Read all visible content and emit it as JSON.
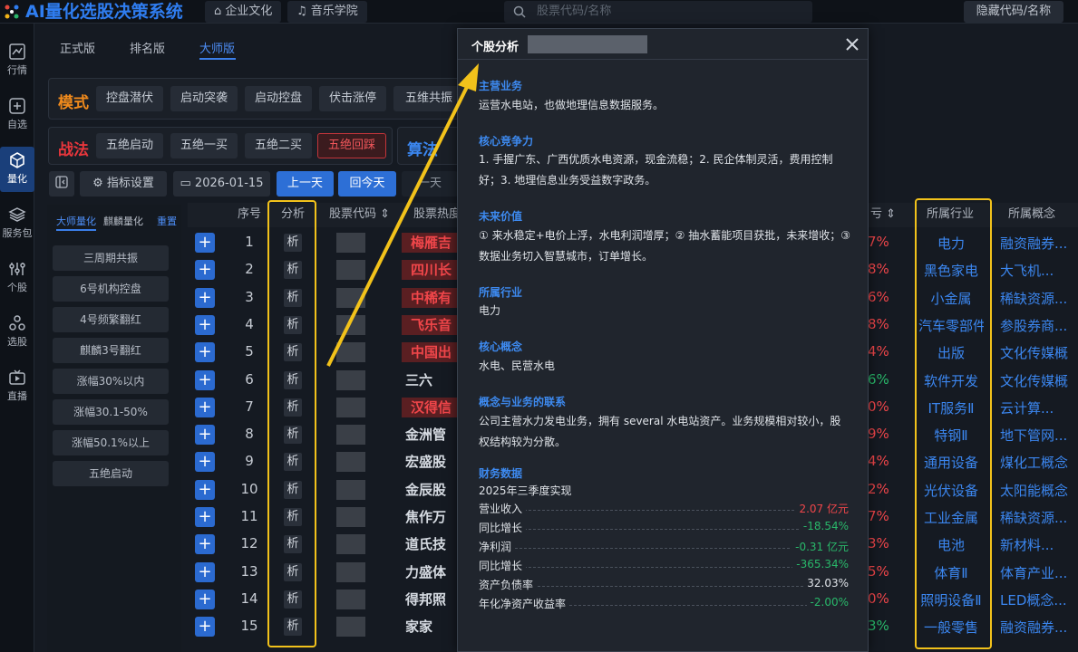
{
  "app": {
    "title": "AI量化选股决策系统",
    "top_buttons": [
      "企业文化",
      "音乐学院"
    ],
    "search_placeholder": "股票代码/名称",
    "hide_code_label": "隐藏代码/名称"
  },
  "left_nav": [
    {
      "label": "行情",
      "icon": "chart-icon"
    },
    {
      "label": "自选",
      "icon": "add-watchlist-icon"
    },
    {
      "label": "量化",
      "icon": "cube-icon",
      "active": true
    },
    {
      "label": "服务包",
      "icon": "layers-icon"
    },
    {
      "label": "个股",
      "icon": "sliders-icon"
    },
    {
      "label": "选股",
      "icon": "nodes-icon"
    },
    {
      "label": "直播",
      "icon": "tv-icon"
    }
  ],
  "version_tabs": [
    "正式版",
    "排名版",
    "大师版"
  ],
  "mode_row": {
    "label": "模式",
    "buttons": [
      "控盘潜伏",
      "启动突袭",
      "启动控盘",
      "伏击涨停",
      "五维共振"
    ]
  },
  "tactic_row": {
    "label": "战法",
    "buttons": [
      "五绝启动",
      "五绝一买",
      "五绝二买",
      "五绝回踩"
    ],
    "active_index": 3,
    "algo_label": "算法"
  },
  "toolbar": {
    "indicator_settings": "指标设置",
    "date": "2026-01-15",
    "prev_day": "上一天",
    "back_today": "回今天",
    "next_day": "一天"
  },
  "sub_panel": {
    "tabs": [
      "大师量化",
      "麒麟量化"
    ],
    "reset": "重置",
    "strategies": [
      "三周期共振",
      "6号机构控盘",
      "4号频繁翻红",
      "麒麟3号翻红",
      "涨幅30%以内",
      "涨幅30.1-50%",
      "涨幅50.1%以上",
      "五绝启动"
    ]
  },
  "table": {
    "headers": {
      "seq": "序号",
      "analysis": "分析",
      "code": "股票代码",
      "heat": "股票热度",
      "pnl": "亏",
      "industry": "所属行业",
      "concept": "所属概念"
    },
    "analysis_label": "析",
    "rows": [
      {
        "seq": "1",
        "name": "梅雁吉",
        "hot": true,
        "pct": "7%",
        "pct_color": "#f0464a",
        "industry": "电力",
        "concept": "融资融券..."
      },
      {
        "seq": "2",
        "name": "四川长",
        "hot": true,
        "pct": "8%",
        "pct_color": "#f0464a",
        "industry": "黑色家电",
        "concept": "大飞机..."
      },
      {
        "seq": "3",
        "name": "中稀有",
        "hot": true,
        "pct": "6%",
        "pct_color": "#f0464a",
        "industry": "小金属",
        "concept": "稀缺资源..."
      },
      {
        "seq": "4",
        "name": "飞乐音",
        "hot": true,
        "pct": "8%",
        "pct_color": "#f0464a",
        "industry": "汽车零部件",
        "concept": "参股券商..."
      },
      {
        "seq": "5",
        "name": "中国出",
        "hot": true,
        "pct": "4%",
        "pct_color": "#f0464a",
        "industry": "出版",
        "concept": "文化传媒概"
      },
      {
        "seq": "6",
        "name": "三六",
        "hot": false,
        "pct": "6%",
        "pct_color": "#29b86a",
        "industry": "软件开发",
        "concept": "文化传媒概"
      },
      {
        "seq": "7",
        "name": "汉得信",
        "hot": true,
        "pct": "0%",
        "pct_color": "#f0464a",
        "industry": "IT服务Ⅱ",
        "concept": "云计算..."
      },
      {
        "seq": "8",
        "name": "金洲管",
        "hot": false,
        "pct": "9%",
        "pct_color": "#f0464a",
        "industry": "特钢Ⅱ",
        "concept": "地下管网..."
      },
      {
        "seq": "9",
        "name": "宏盛股",
        "hot": false,
        "pct": "4%",
        "pct_color": "#f0464a",
        "industry": "通用设备",
        "concept": "煤化工概念"
      },
      {
        "seq": "10",
        "name": "金辰股",
        "hot": false,
        "pct": "2%",
        "pct_color": "#f0464a",
        "industry": "光伏设备",
        "concept": "太阳能概念"
      },
      {
        "seq": "11",
        "name": "焦作万",
        "hot": false,
        "pct": "7%",
        "pct_color": "#f0464a",
        "industry": "工业金属",
        "concept": "稀缺资源..."
      },
      {
        "seq": "12",
        "name": "道氏技",
        "hot": false,
        "pct": "3%",
        "pct_color": "#f0464a",
        "industry": "电池",
        "concept": "新材料..."
      },
      {
        "seq": "13",
        "name": "力盛体",
        "hot": false,
        "pct": "5%",
        "pct_color": "#f0464a",
        "industry": "体育Ⅱ",
        "concept": "体育产业..."
      },
      {
        "seq": "14",
        "name": "得邦照",
        "hot": false,
        "pct": "0%",
        "pct_color": "#f0464a",
        "industry": "照明设备Ⅱ",
        "concept": "LED概念..."
      },
      {
        "seq": "15",
        "name": "家家",
        "hot": false,
        "pct": "3%",
        "pct_color": "#29b86a",
        "industry": "一般零售",
        "concept": "融资融券..."
      }
    ]
  },
  "modal": {
    "title": "个股分析",
    "sections": {
      "main_business_title": "主营业务",
      "main_business": "运营水电站，也做地理信息数据服务。",
      "core_comp_title": "核心竞争力",
      "core_comp": "1. 手握广东、广西优质水电资源，现金流稳；2. 民企体制灵活，费用控制好；3. 地理信息业务受益数字政务。",
      "future_title": "未来价值",
      "future": "① 来水稳定+电价上浮，水电利润增厚；② 抽水蓄能项目获批，未来增收；③ 数据业务切入智慧城市，订单增长。",
      "industry_title": "所属行业",
      "industry": "电力",
      "concept_title": "核心概念",
      "concept": "水电、民营水电",
      "link_title": "概念与业务的联系",
      "link": "公司主营水力发电业务，拥有 several 水电站资产。业务规模相对较小，股权结构较为分散。",
      "fin_title": "财务数据",
      "fin_period": "2025年三季度实现"
    },
    "financials": [
      {
        "label": "营业收入",
        "value": "2.07 亿元",
        "color": "#f0464a"
      },
      {
        "label": "同比增长",
        "value": "-18.54%",
        "color": "#29b86a"
      },
      {
        "label": "净利润",
        "value": "-0.31 亿元",
        "color": "#29b86a"
      },
      {
        "label": "同比增长",
        "value": "-365.34%",
        "color": "#29b86a"
      },
      {
        "label": "资产负债率",
        "value": "32.03%",
        "color": "#dfe3e8"
      },
      {
        "label": "年化净资产收益率",
        "value": "-2.00%",
        "color": "#29b86a"
      }
    ]
  }
}
